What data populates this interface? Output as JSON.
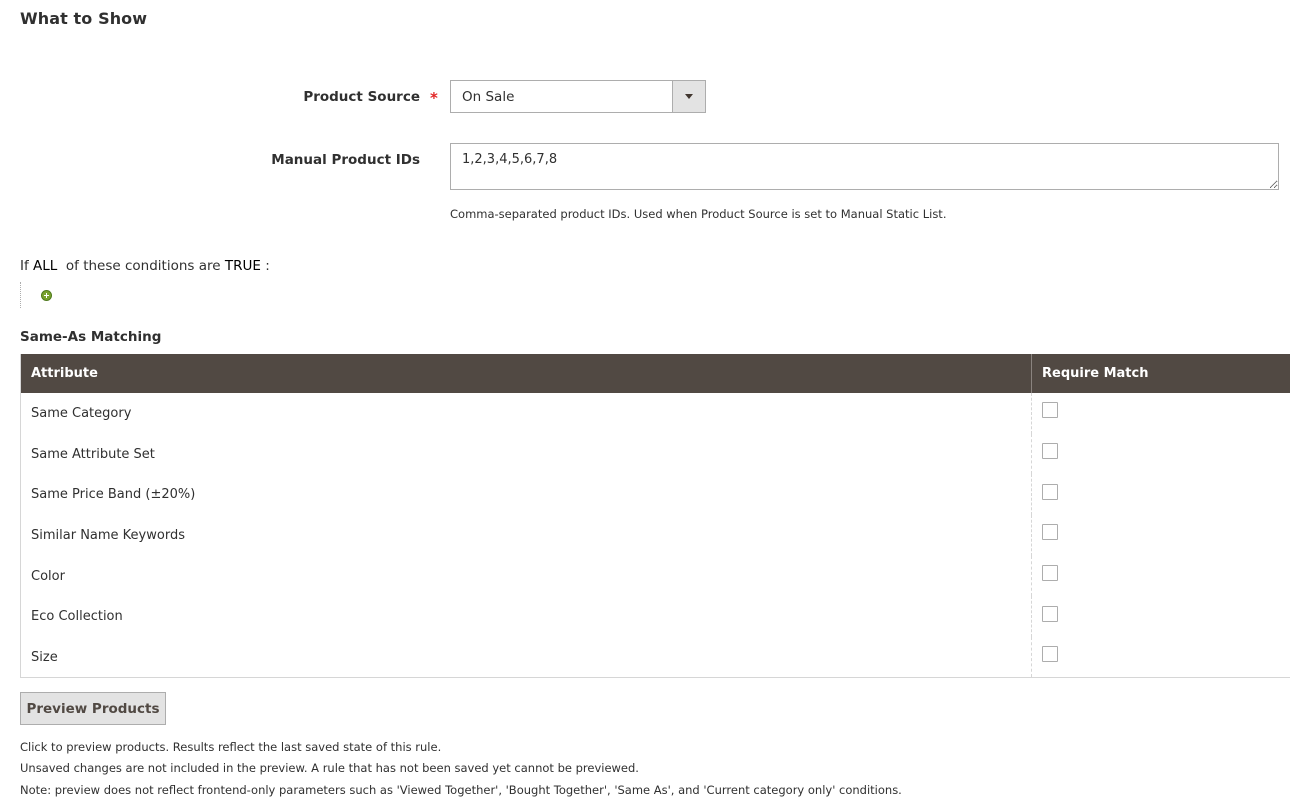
{
  "section": {
    "title": "What to Show"
  },
  "product_source": {
    "label": "Product Source",
    "required_marker": "*",
    "selected_value": "On Sale"
  },
  "manual_ids": {
    "label": "Manual Product IDs",
    "value": "1,2,3,4,5,6,7,8",
    "note": "Comma-separated product IDs. Used when Product Source is set to Manual Static List."
  },
  "conditions": {
    "prefix": "If ",
    "aggregator": "ALL",
    "middle": "  of these conditions are ",
    "value": "TRUE",
    "suffix": " :"
  },
  "same_as": {
    "heading": "Same-As Matching",
    "columns": [
      "Attribute",
      "Require Match"
    ],
    "rows": [
      {
        "attribute": "Same Category",
        "checked": false
      },
      {
        "attribute": "Same Attribute Set",
        "checked": false
      },
      {
        "attribute": "Same Price Band (±20%)",
        "checked": false
      },
      {
        "attribute": "Similar Name Keywords",
        "checked": false
      },
      {
        "attribute": "Color",
        "checked": false
      },
      {
        "attribute": "Eco Collection",
        "checked": false
      },
      {
        "attribute": "Size",
        "checked": false
      }
    ]
  },
  "preview": {
    "button_label": "Preview Products",
    "notes": [
      "Click to preview products. Results reflect the last saved state of this rule.",
      "Unsaved changes are not included in the preview. A rule that has not been saved yet cannot be previewed.",
      "Note: preview does not reflect frontend-only parameters such as 'Viewed Together', 'Bought Together', 'Same As', and 'Current category only' conditions."
    ]
  },
  "colors": {
    "table_header_bg": "#514943",
    "required_star": "#e22626",
    "add_icon": "#79a22e"
  }
}
